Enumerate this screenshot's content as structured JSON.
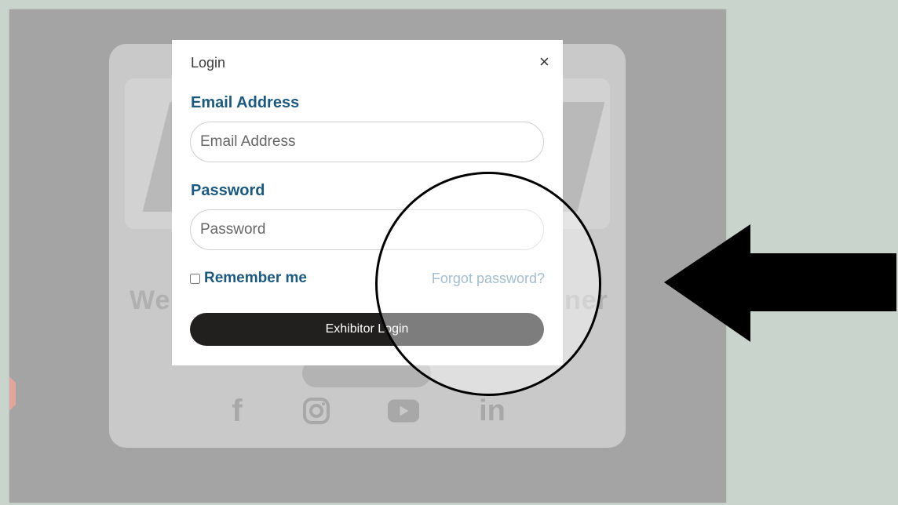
{
  "modal": {
    "title": "Login",
    "close_icon": "×",
    "email": {
      "label": "Email Address",
      "placeholder": "Email Address",
      "value": ""
    },
    "password": {
      "label": "Password",
      "placeholder": "Password",
      "value": ""
    },
    "remember_label": "Remember me",
    "remember_checked": false,
    "forgot_label": "Forgot password?",
    "submit_label": "Exhibitor Login"
  },
  "background": {
    "welcome_left": "We",
    "welcome_right": "ner",
    "social_icons": [
      "facebook-icon",
      "instagram-icon",
      "youtube-icon",
      "linkedin-icon"
    ],
    "social_glyphs": {
      "facebook": "f",
      "linkedin": "in"
    }
  },
  "annotation": {
    "circle_icon": "highlight-circle",
    "arrow_icon": "left-arrow-icon",
    "arrow_color": "#000000"
  },
  "colors": {
    "accent": "#1a5a80",
    "link": "#5f8fae",
    "button": "#221f1f",
    "overlay": "#a4a4a4",
    "page_bg": "#c9d4cc"
  }
}
